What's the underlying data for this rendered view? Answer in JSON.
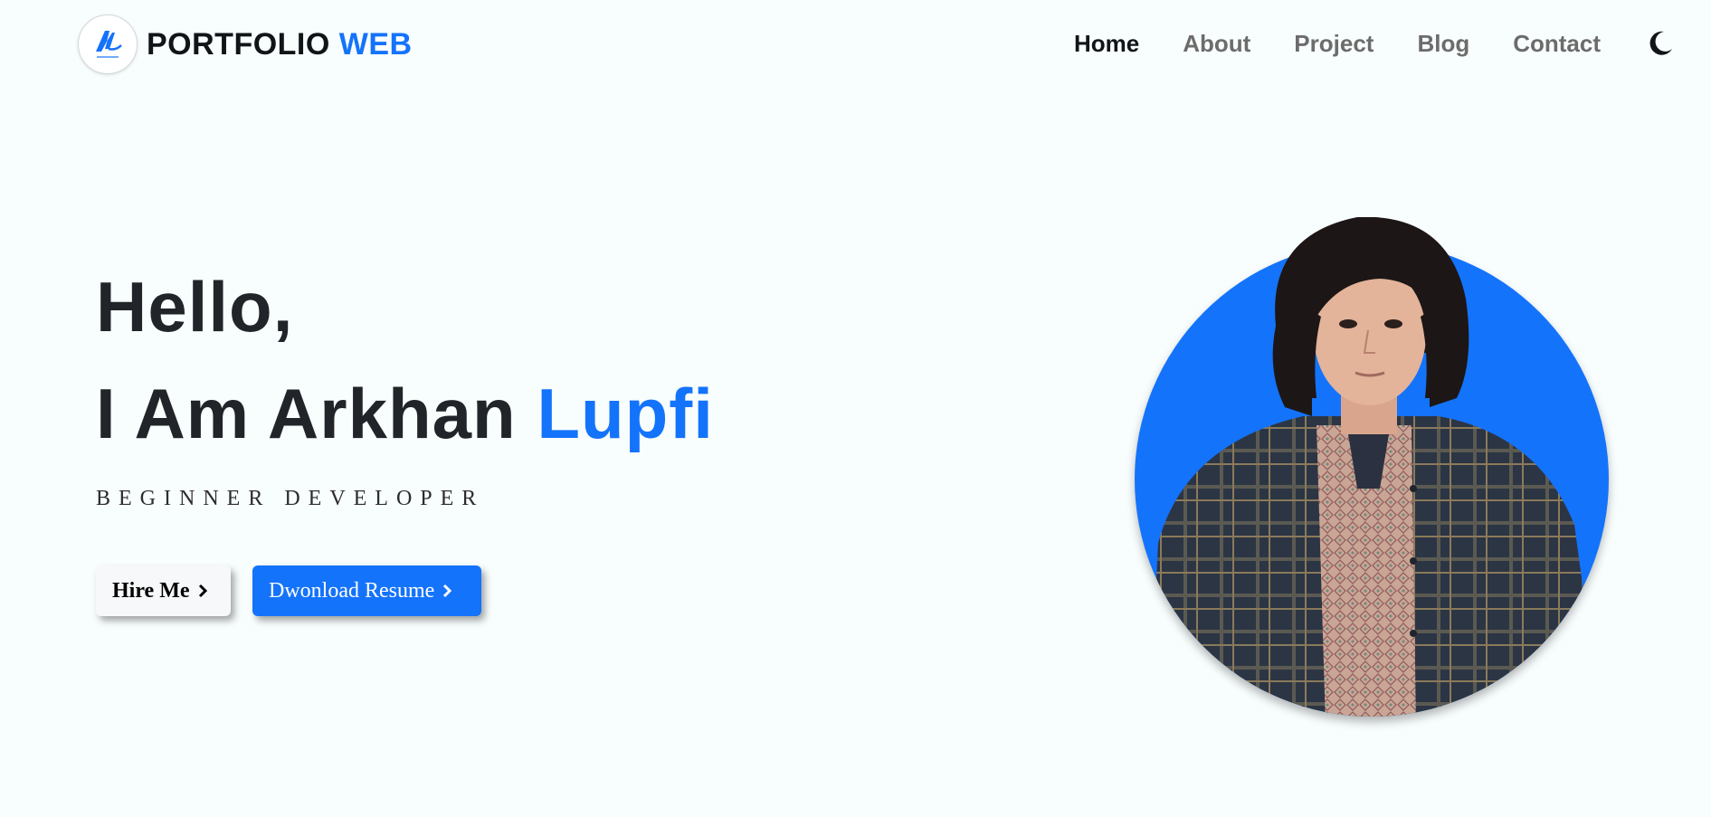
{
  "colors": {
    "accent": "#1473fb",
    "text": "#212529",
    "muted": "#6c6c6c",
    "background": "#f8fdfd"
  },
  "brand": {
    "logo_icon": "logo-monogram-icon",
    "name": "PORTFOLIO",
    "accent": "WEB"
  },
  "nav": {
    "items": [
      {
        "label": "Home",
        "active": true
      },
      {
        "label": "About",
        "active": false
      },
      {
        "label": "Project",
        "active": false
      },
      {
        "label": "Blog",
        "active": false
      },
      {
        "label": "Contact",
        "active": false
      }
    ],
    "theme_toggle_icon": "moon-icon"
  },
  "hero": {
    "greeting": "Hello,",
    "headline_prefix": "I Am Arkhan",
    "headline_accent": "Lupfi",
    "subtitle": "BEGINNER DEVELOPER",
    "buttons": {
      "hire": "Hire Me",
      "resume": "Dwonload Resume"
    }
  },
  "profile": {
    "image_icon": "profile-photo"
  }
}
